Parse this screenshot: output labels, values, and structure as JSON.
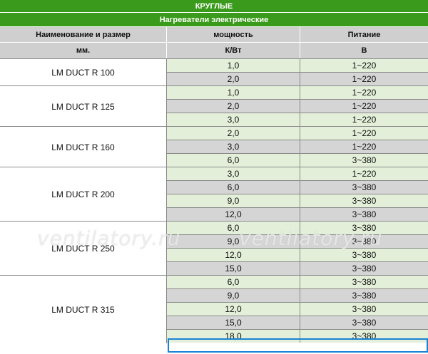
{
  "table": {
    "title": "КРУГЛЫЕ",
    "subtitle": "Нагреватели электрические",
    "headers": {
      "name_line1": "Наименование и размер",
      "name_line2": "мм.",
      "power_line1": "мощность",
      "power_line2": "К/Вт",
      "supply_line1": "Питание",
      "supply_line2": "В"
    },
    "groups": [
      {
        "name": "LM DUCT R 100",
        "rows": [
          {
            "power": "1,0",
            "supply": "1~220"
          },
          {
            "power": "2,0",
            "supply": "1~220"
          }
        ]
      },
      {
        "name": "LM DUCT R 125",
        "rows": [
          {
            "power": "1,0",
            "supply": "1~220"
          },
          {
            "power": "2,0",
            "supply": "1~220"
          },
          {
            "power": "3,0",
            "supply": "1~220"
          }
        ]
      },
      {
        "name": "LM DUCT R 160",
        "rows": [
          {
            "power": "2,0",
            "supply": "1~220"
          },
          {
            "power": "3,0",
            "supply": "1~220"
          },
          {
            "power": "6,0",
            "supply": "3~380"
          }
        ]
      },
      {
        "name": "LM DUCT R 200",
        "rows": [
          {
            "power": "3,0",
            "supply": "1~220"
          },
          {
            "power": "6,0",
            "supply": "3~380"
          },
          {
            "power": "9,0",
            "supply": "3~380"
          },
          {
            "power": "12,0",
            "supply": "3~380"
          }
        ]
      },
      {
        "name": "LM DUCT R 250",
        "rows": [
          {
            "power": "6,0",
            "supply": "3~380"
          },
          {
            "power": "9,0",
            "supply": "3~380"
          },
          {
            "power": "12,0",
            "supply": "3~380"
          },
          {
            "power": "15,0",
            "supply": "3~380"
          }
        ]
      },
      {
        "name": "LM DUCT R 315",
        "rows": [
          {
            "power": "6,0",
            "supply": "3~380"
          },
          {
            "power": "9,0",
            "supply": "3~380"
          },
          {
            "power": "12,0",
            "supply": "3~380"
          },
          {
            "power": "15,0",
            "supply": "3~380"
          },
          {
            "power": "18,0",
            "supply": "3~380"
          }
        ]
      }
    ]
  },
  "watermark": {
    "left": "ventilatory.ru",
    "right": "ventilatory.ru"
  },
  "colors": {
    "header_green": "#3a9a1b",
    "header_gray": "#cfcfcf",
    "row_light_green": "#e3efd8",
    "row_gray": "#d5d5d5",
    "selection_blue": "#1a83d6"
  }
}
